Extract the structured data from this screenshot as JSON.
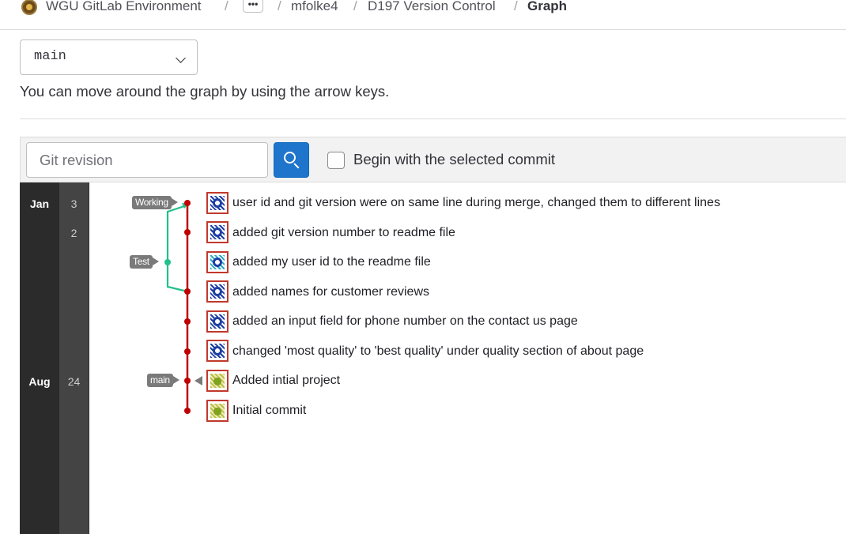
{
  "breadcrumb": {
    "group": "WGU GitLab Environment",
    "ellipsis": "•••",
    "user": "mfolke4",
    "project": "D197 Version Control",
    "current": "Graph",
    "separator": "/"
  },
  "branch_select": {
    "value": "main"
  },
  "hint": "You can move around the graph by using the arrow keys.",
  "controls": {
    "revision_placeholder": "Git revision",
    "begin_label": "Begin with the selected commit",
    "begin_checked": false
  },
  "dates": {
    "months": [
      "Jan",
      "Aug"
    ],
    "days": [
      "3",
      "2",
      "24"
    ]
  },
  "refs": [
    "Working",
    "Test",
    "main"
  ],
  "commits": [
    {
      "message": "user id and git version were on same line during merge, changed them to different lines",
      "avatar": "blue-identicon"
    },
    {
      "message": "added git version number to readme file",
      "avatar": "blue-identicon"
    },
    {
      "message": "added my user id to the readme file",
      "avatar": "teal-identicon"
    },
    {
      "message": "added names for customer reviews",
      "avatar": "blue-identicon"
    },
    {
      "message": "added an input field for phone number on the contact us page",
      "avatar": "blue-identicon"
    },
    {
      "message": "changed 'most quality' to 'best quality' under quality section of about page",
      "avatar": "blue-identicon"
    },
    {
      "message": "Added intial project",
      "avatar": "green-identicon"
    },
    {
      "message": "Initial commit",
      "avatar": "green-identicon"
    }
  ],
  "colors": {
    "main_branch": "#c00000",
    "test_branch": "#22c08a",
    "primary_button": "#1f75cb",
    "ref_label": "#7a7a7a"
  }
}
